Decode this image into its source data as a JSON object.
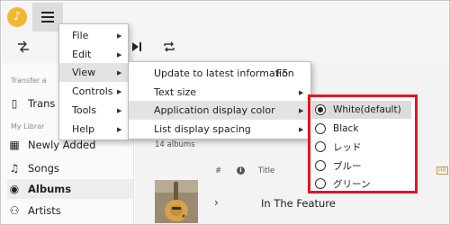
{
  "topbar": {
    "logo_icon": "music-note-icon",
    "menu_icon": "hamburger-icon"
  },
  "toolbar": {
    "icons": [
      "shuffle-icon",
      "next-track-icon",
      "repeat-icon"
    ]
  },
  "sidebar": {
    "section_transfer": "Transfer a",
    "transfer_label": "Trans",
    "section_library": "My Librar",
    "items": [
      {
        "label": "Newly Added",
        "icon": "grid-icon"
      },
      {
        "label": "Songs",
        "icon": "music-note-icon"
      },
      {
        "label": "Albums",
        "icon": "disc-icon"
      },
      {
        "label": "Artists",
        "icon": "person-icon"
      }
    ]
  },
  "main": {
    "album_count": "14 albums",
    "col_number": "#",
    "col_title": "Title",
    "hr_badge": "HR",
    "album_title": "In The Feature"
  },
  "menu_main": {
    "items": [
      {
        "label": "File"
      },
      {
        "label": "Edit"
      },
      {
        "label": "View"
      },
      {
        "label": "Controls"
      },
      {
        "label": "Tools"
      },
      {
        "label": "Help"
      }
    ]
  },
  "menu_view": {
    "items": [
      {
        "label": "Update to latest information",
        "shortcut": "F5"
      },
      {
        "label": "Text size"
      },
      {
        "label": "Application display color"
      },
      {
        "label": "List display spacing"
      }
    ]
  },
  "menu_color": {
    "options": [
      {
        "label": "White(default)",
        "selected": true
      },
      {
        "label": "Black",
        "selected": false
      },
      {
        "label": "レッド",
        "selected": false
      },
      {
        "label": "ブルー",
        "selected": false
      },
      {
        "label": "グリーン",
        "selected": false
      }
    ]
  },
  "colors": {
    "highlight": "#e0161f",
    "logo": "#f2b632"
  }
}
